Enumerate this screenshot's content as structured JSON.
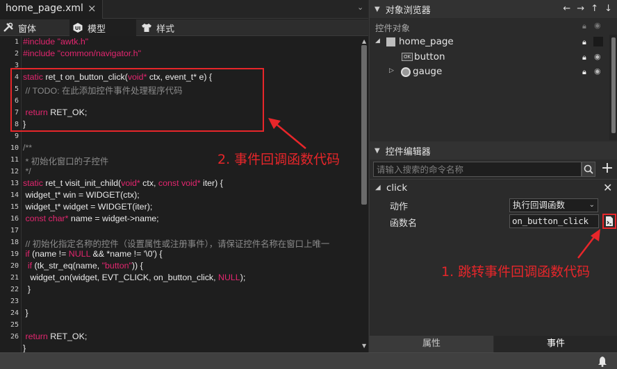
{
  "editor_tab": {
    "title": "home_page.xml",
    "close": "×",
    "more": "⌄"
  },
  "modes": [
    {
      "label": "窗体",
      "icon": "tools-icon"
    },
    {
      "label": "模型",
      "icon": "ui-icon"
    },
    {
      "label": "样式",
      "icon": "shirt-icon"
    }
  ],
  "code": {
    "line_numbers": [
      "1",
      "2",
      "3",
      "4",
      "5",
      "6",
      "7",
      "8",
      "9",
      "10",
      "11",
      "12",
      "13",
      "14",
      "15",
      "16",
      "17",
      "18",
      "19",
      "20",
      "21",
      "22",
      "23",
      "24",
      "25",
      "26"
    ],
    "l1": "#include \"awtk.h\"",
    "l2": "#include \"common/navigator.h\"",
    "l4_kw": "static",
    "l4_mid": " ret_t on_button_click(",
    "l4_kw2": "void*",
    "l4_end": " ctx, event_t* e) {",
    "l5": " // TODO: 在此添加控件事件处理程序代码",
    "l7_kw": " return",
    "l7_end": " RET_OK;",
    "l8": "}",
    "l10": "/**",
    "l11": " * 初始化窗口的子控件",
    "l12": " */",
    "l13_kw": "static",
    "l13_mid": " ret_t visit_init_child(",
    "l13_kw2": "void*",
    "l13_mid2": " ctx, ",
    "l13_kw3": "const void*",
    "l13_end": " iter) {",
    "l14": " widget_t* win = WIDGET(ctx);",
    "l15": " widget_t* widget = WIDGET(iter);",
    "l16_kw": " const char*",
    "l16_end": " name = widget->name;",
    "l18": " // 初始化指定名称的控件（设置属性或注册事件），请保证控件名称在窗口上唯一",
    "l19_kw": " if",
    "l19_mid": " (name != ",
    "l19_null": "NULL",
    "l19_end": " && *name != '\\0') {",
    "l20_kw": "  if",
    "l20_mid": " (tk_str_eq(name, ",
    "l20_str": "\"button\"",
    "l20_end": ")) {",
    "l21_a": "   widget_on(widget, EVT_CLICK, on_button_click, ",
    "l21_null": "NULL",
    "l21_end": ");",
    "l22": "  }",
    "l24": " }",
    "l26_kw": " return",
    "l26_end": " RET_OK;",
    "l27": "}"
  },
  "annotations": {
    "code_label": "2. 事件回调函数代码",
    "jump_label": "1. 跳转事件回调函数代码",
    "color": "#e8262a"
  },
  "object_browser": {
    "title": "对象浏览器",
    "column_label": "控件对象",
    "tools": [
      "←",
      "→",
      "↑",
      "↓"
    ],
    "tree": [
      {
        "label": "home_page",
        "expanded": true
      },
      {
        "label": "button",
        "icon_text": "OK"
      },
      {
        "label": "gauge",
        "expanded": false
      }
    ]
  },
  "widget_editor": {
    "title": "控件编辑器",
    "search_placeholder": "请输入搜索的命令名称",
    "add": "+",
    "event": {
      "name": "click",
      "close": "✕"
    },
    "action_label": "动作",
    "action_value": "执行回调函数",
    "func_label": "函数名",
    "func_value": "on_button_click"
  },
  "bottom_tabs": {
    "props": "属性",
    "events": "事件"
  }
}
